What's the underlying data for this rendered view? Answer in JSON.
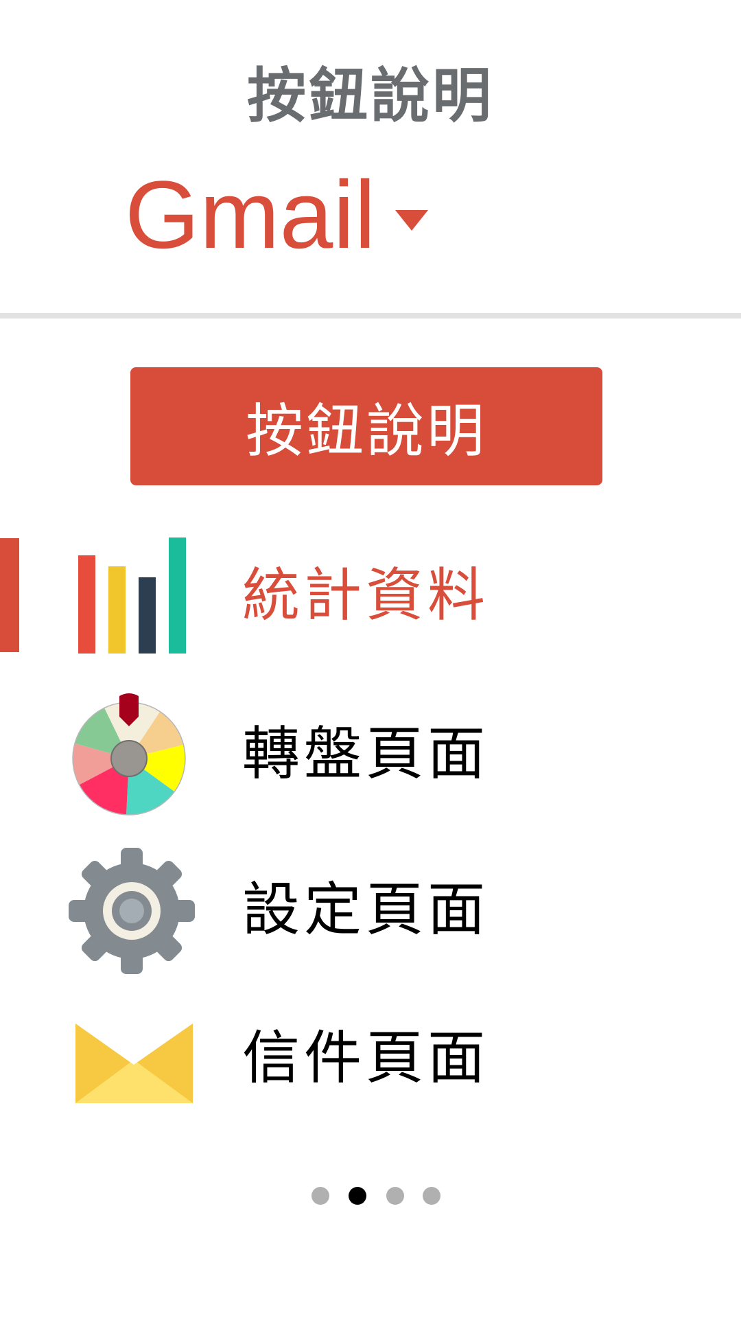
{
  "header": {
    "title": "按鈕說明",
    "account_name": "Gmail",
    "dropdown_icon": "caret-down-icon"
  },
  "help_button": {
    "label": "按鈕說明",
    "color": "#d84d3a"
  },
  "menu": {
    "items": [
      {
        "label": "統計資料",
        "icon": "bar-chart-icon",
        "active": true
      },
      {
        "label": "轉盤頁面",
        "icon": "spin-wheel-icon",
        "active": false
      },
      {
        "label": "設定頁面",
        "icon": "gear-icon",
        "active": false
      },
      {
        "label": "信件頁面",
        "icon": "envelope-icon",
        "active": false
      }
    ]
  },
  "pager": {
    "total_pages": 4,
    "current_page": 2
  },
  "colors": {
    "accent": "#d94e3b",
    "title_gray": "#6a6d70",
    "divider": "#e2e2e2"
  }
}
